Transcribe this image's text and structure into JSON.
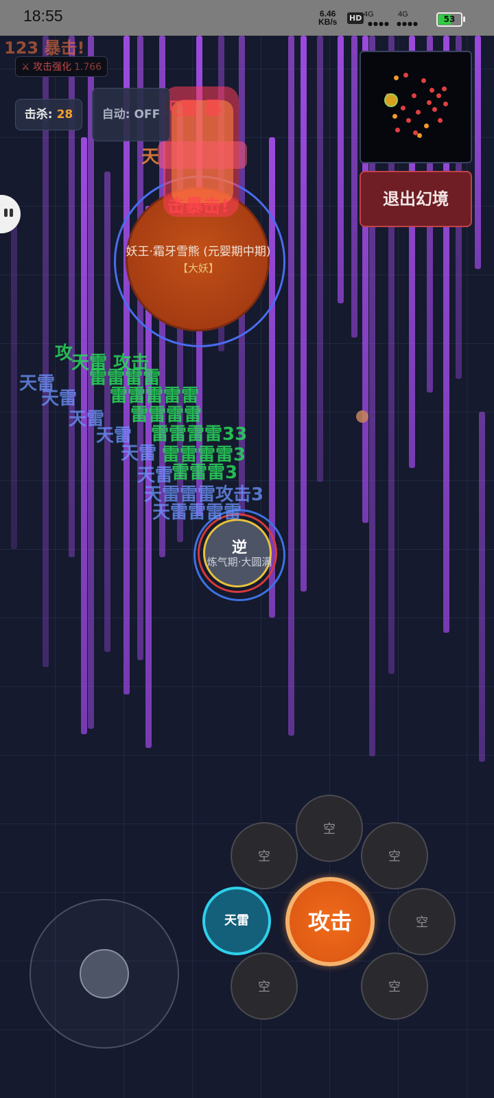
{
  "status_bar": {
    "time": "18:55",
    "net_speed": "6.46",
    "net_unit": "KB/s",
    "hd_label": "HD",
    "sim1_label": "4G",
    "sim2_label": "4G",
    "battery": "53"
  },
  "hud": {
    "faded_top_text": "123 暴击!",
    "buff_label": "⚔ 攻击强化",
    "buff_value": "1.766",
    "kill_label": "击杀:",
    "kill_count": "28",
    "auto_label": "自动: OFF",
    "exit_label": "退出幻境"
  },
  "boss": {
    "name": "妖王·霜牙雪熊 (元婴期中期)",
    "tag": "【大妖】"
  },
  "player": {
    "name": "逆",
    "realm": "炼气期·大圆满"
  },
  "controls": {
    "skill_active": "天雷",
    "attack": "攻击",
    "empty_slot": "空"
  },
  "colors": {
    "background": "#151a2e",
    "laser": "#a650f0",
    "boss_core": "#b5461a",
    "attack_button": "#e35f16",
    "skill_ring": "#2fd0ea",
    "exit_button": "#6e1e24",
    "kill_count": "#f5a030"
  },
  "icons": {
    "side_tab": "robot-face-icon",
    "minimap_player": "player-marker-icon"
  }
}
